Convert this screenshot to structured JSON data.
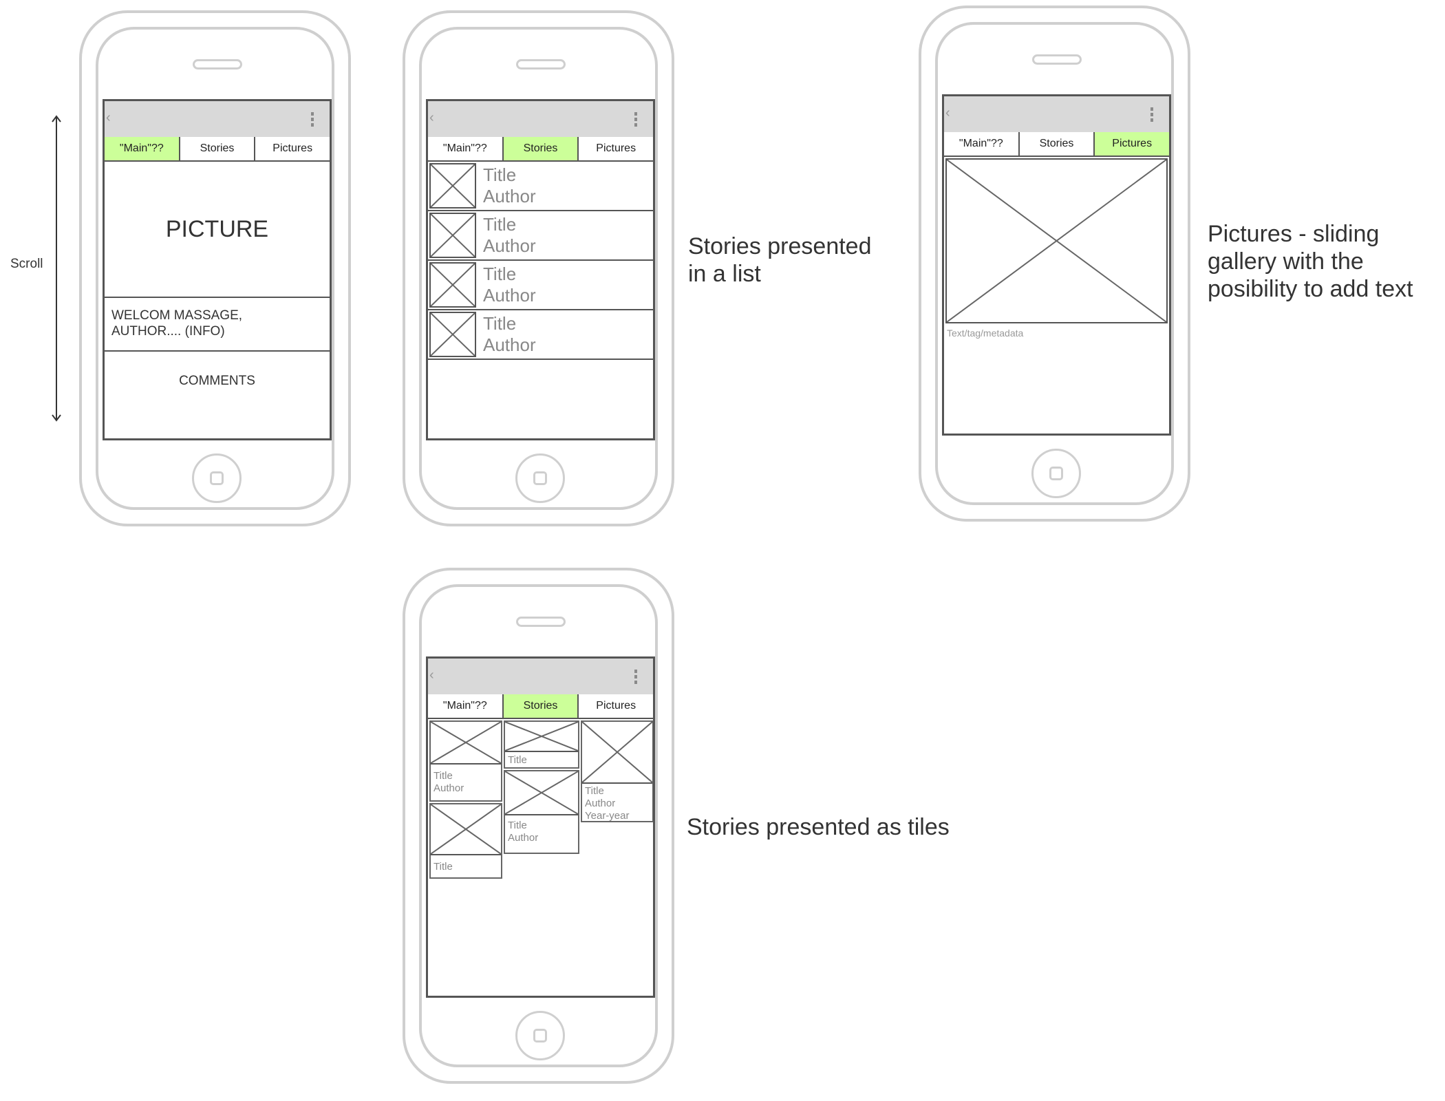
{
  "tabs": {
    "main": "\"Main\"??",
    "stories": "Stories",
    "pictures": "Pictures"
  },
  "phone_main": {
    "picture": "PICTURE",
    "welcome": "WELCOM MASSAGE,\nAUTHOR.... (INFO)",
    "comments": "COMMENTS"
  },
  "scroll_label": "Scroll",
  "phone_list": {
    "items": [
      {
        "title": "Title",
        "author": "Author"
      },
      {
        "title": "Title",
        "author": "Author"
      },
      {
        "title": "Title",
        "author": "Author"
      },
      {
        "title": "Title",
        "author": "Author"
      }
    ]
  },
  "phone_gallery": {
    "meta": "Text/tag/metadata"
  },
  "phone_tiles": {
    "col1": [
      {
        "title": "Title",
        "author": "Author"
      },
      {
        "title": "Title"
      }
    ],
    "col2": [
      {
        "title": "Title"
      },
      {
        "title": "Title",
        "author": "Author"
      }
    ],
    "col3": [
      {
        "title": "Title",
        "author": "Author",
        "years": "Year-year"
      }
    ]
  },
  "annotations": {
    "list": "Stories presented\nin a list",
    "gallery": "Pictures - sliding\ngallery with the\nposibility to add text",
    "tiles": "Stories presented as tiles"
  },
  "colors": {
    "active_tab": "#ccff99",
    "topbar": "#d9d9d9",
    "phone_outline": "#cfcfcf"
  }
}
